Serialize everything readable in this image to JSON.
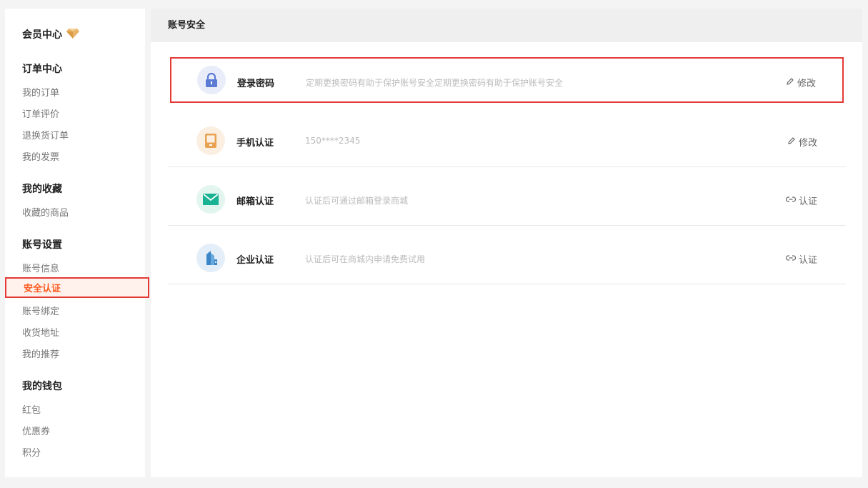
{
  "sidebar": {
    "title": "会员中心",
    "groups": [
      {
        "title": "订单中心",
        "items": [
          "我的订单",
          "订单评价",
          "退换货订单",
          "我的发票"
        ]
      },
      {
        "title": "我的收藏",
        "items": [
          "收藏的商品"
        ]
      },
      {
        "title": "账号设置",
        "items": [
          "账号信息",
          "安全认证",
          "账号绑定",
          "收货地址",
          "我的推荐"
        ]
      },
      {
        "title": "我的钱包",
        "items": [
          "红包",
          "优惠券",
          "积分"
        ]
      }
    ],
    "active_item": "安全认证"
  },
  "main": {
    "header": "账号安全",
    "rows": [
      {
        "title": "登录密码",
        "desc": "定期更换密码有助于保护账号安全定期更换密码有助于保护账号安全",
        "action": "修改",
        "icon": "lock-icon",
        "color": "#5b7bd5"
      },
      {
        "title": "手机认证",
        "desc": "150****2345",
        "action": "修改",
        "icon": "phone-icon",
        "color": "#e8a251"
      },
      {
        "title": "邮箱认证",
        "desc": "认证后可通过邮箱登录商城",
        "action": "认证",
        "icon": "mail-icon",
        "color": "#19b394"
      },
      {
        "title": "企业认证",
        "desc": "认证后可在商城内申请免费试用",
        "action": "认证",
        "icon": "building-icon",
        "color": "#3a86c8"
      }
    ]
  }
}
